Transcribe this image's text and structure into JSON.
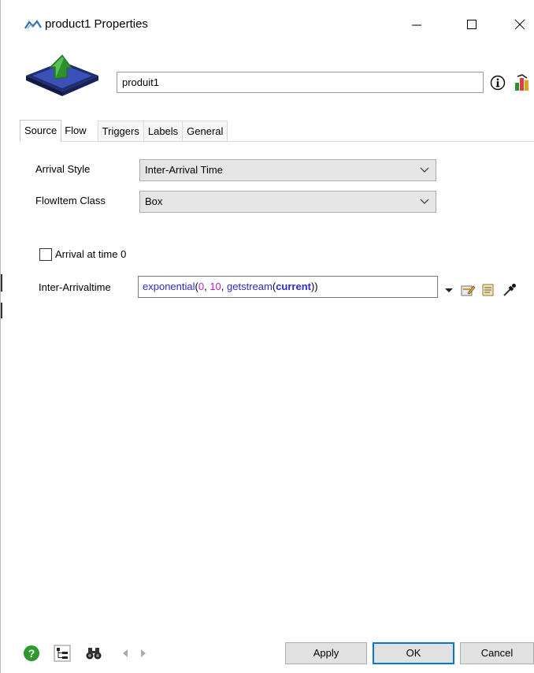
{
  "window": {
    "title": "product1  Properties"
  },
  "header": {
    "name_value": "produit1"
  },
  "tabs": [
    {
      "label": "Source",
      "active": true
    },
    {
      "label": "Flow",
      "active": false
    },
    {
      "label": "Triggers",
      "active": false
    },
    {
      "label": "Labels",
      "active": false
    },
    {
      "label": "General",
      "active": false
    }
  ],
  "source": {
    "arrival_style_label": "Arrival Style",
    "arrival_style_value": "Inter-Arrival Time",
    "flowitem_class_label": "FlowItem Class",
    "flowitem_class_value": "Box",
    "arrival_at_zero_label": "Arrival at time 0",
    "arrival_at_zero_checked": false,
    "interarrival_label": "Inter-Arrivaltime",
    "interarrival_code": {
      "fn": "exponential",
      "open": "(",
      "arg1": "0",
      "sep1": ", ",
      "arg2": "10",
      "sep2": ", ",
      "inner_fn": "getstream",
      "open2": "(",
      "inner_arg": "current",
      "close": "))"
    }
  },
  "footer": {
    "apply_label": "Apply",
    "ok_label": "OK",
    "cancel_label": "Cancel"
  },
  "icons": {
    "title": "flexsim-logo-icon",
    "help": "help-icon",
    "tree": "tree-view-icon",
    "find": "binoculars-icon",
    "prev": "previous-arrow-icon",
    "next": "next-arrow-icon"
  },
  "colors": {
    "accent": "#0078d7",
    "code_function": "#2b2bd6",
    "code_number": "#c020c0"
  }
}
